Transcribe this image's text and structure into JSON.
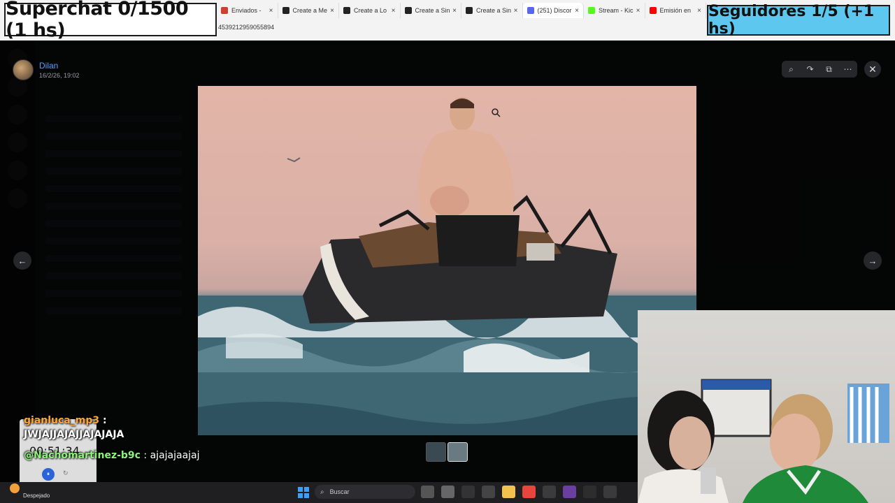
{
  "overlays": {
    "superchat": "Superchat 0/1500 (1 hs)",
    "followers": "Seguidores 1/5 (+1 hs)"
  },
  "browser": {
    "tabs": [
      {
        "label": "Enviados - ",
        "color": "#d23f31"
      },
      {
        "label": "Create a Me",
        "color": "#222222"
      },
      {
        "label": "Create a Lo",
        "color": "#222222"
      },
      {
        "label": "Create a Sin",
        "color": "#222222"
      },
      {
        "label": "Create a Sin",
        "color": "#222222"
      },
      {
        "label": "(251) Discor",
        "color": "#5865f2",
        "active": true
      },
      {
        "label": "Stream - Kic",
        "color": "#53fc18"
      },
      {
        "label": "Emisión en",
        "color": "#ff0000"
      }
    ],
    "close_glyph": "×",
    "url_fragment": "4539212959055894"
  },
  "viewer": {
    "uploader_name": "Dilan",
    "uploader_date": "16/2/26, 19:02",
    "tools": [
      {
        "icon": "zoom-icon",
        "glyph": "⌕"
      },
      {
        "icon": "forward-icon",
        "glyph": "↷"
      },
      {
        "icon": "open-external-icon",
        "glyph": "⧉"
      },
      {
        "icon": "more-icon",
        "glyph": "⋯"
      }
    ],
    "close_glyph": "✕",
    "prev_glyph": "←",
    "next_glyph": "→",
    "thumb_count": 2,
    "active_thumb": 2
  },
  "chat": {
    "messages": [
      {
        "user": "gianluca_mp3",
        "sep": " :",
        "text": "JWJAJJAJAJJAJAJAJA"
      },
      {
        "user": "@Nachomartinez-b9c",
        "sep": " : ",
        "text": "ajajajaajaj"
      }
    ]
  },
  "timer": {
    "value": "00:51:34",
    "pause_glyph": "⏸",
    "reset_glyph": "↻"
  },
  "taskbar": {
    "weather_text": "Despejado",
    "search_placeholder": "Buscar",
    "search_glyph": "⌕",
    "icons": [
      {
        "name": "taskview-icon",
        "color": "#555555"
      },
      {
        "name": "files-icon",
        "color": "#666666"
      },
      {
        "name": "capcut-icon",
        "color": "#333333"
      },
      {
        "name": "obs-icon",
        "color": "#444444"
      },
      {
        "name": "folder-icon",
        "color": "#f2c14e"
      },
      {
        "name": "chrome-icon",
        "color": "#e8453c"
      },
      {
        "name": "photo-icon",
        "color": "#3b3b3b"
      },
      {
        "name": "app-icon",
        "color": "#6b3fa0"
      },
      {
        "name": "xpo-icon",
        "color": "#2d2d2d"
      },
      {
        "name": "yt-icon",
        "color": "#3a3a3a"
      }
    ]
  }
}
